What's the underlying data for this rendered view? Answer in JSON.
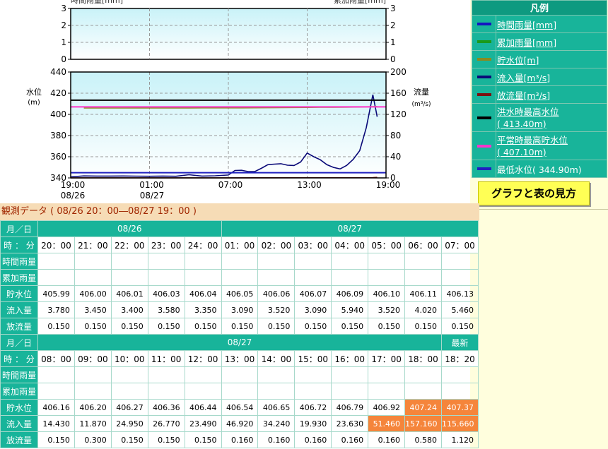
{
  "colors": {
    "teal": "#18b49a",
    "rain_hourly": "#1515c0",
    "rain_cumulative": "#1a9a1a",
    "storage_level": "#8a8a20",
    "inflow": "#0a0a78",
    "outflow": "#7a1010",
    "flood_max": "#000000",
    "normal_max": "#ff33cc",
    "min_level": "#2020c0",
    "alert": "#f5853b"
  },
  "rain_chart": {
    "left_label": "時間雨量[mm]",
    "right_label": "累加雨量[mm]",
    "left_ticks": [
      "3",
      "2",
      "1",
      "0"
    ],
    "right_ticks": [
      "3",
      "2",
      "1",
      "0"
    ]
  },
  "level_chart": {
    "left_axis_label": "水位",
    "left_axis_unit": "(m)",
    "right_axis_label": "流量",
    "right_axis_unit": "(m³/s)",
    "left_ticks": [
      "440",
      "420",
      "400",
      "380",
      "360",
      "340"
    ],
    "right_ticks": [
      "200",
      "160",
      "120",
      "80",
      "40",
      "0"
    ],
    "x_ticks": [
      "19:00",
      "01:00",
      "07:00",
      "13:00",
      "19:00"
    ],
    "date_labels": [
      "08/26",
      "08/27"
    ]
  },
  "chart_data": {
    "type": "line",
    "x_unit": "hours since 08/26 19:00",
    "x_ticks": [
      "19:00",
      "01:00",
      "07:00",
      "13:00",
      "19:00"
    ],
    "y_left": {
      "label": "水位 (m)",
      "range": [
        340,
        440
      ]
    },
    "y_right": {
      "label": "流量 (m³/s)",
      "range": [
        0,
        200
      ]
    },
    "series": [
      {
        "name": "流入量[m³/s]",
        "axis": "right",
        "color": "#0a0a78",
        "points": [
          [
            0,
            2.0
          ],
          [
            1,
            3.78
          ],
          [
            2,
            3.45
          ],
          [
            3,
            3.4
          ],
          [
            4,
            3.58
          ],
          [
            5,
            3.35
          ],
          [
            6,
            3.09
          ],
          [
            7,
            3.52
          ],
          [
            8,
            3.09
          ],
          [
            9,
            5.94
          ],
          [
            10,
            3.52
          ],
          [
            11,
            4.02
          ],
          [
            12,
            5.46
          ],
          [
            12.5,
            14.0
          ],
          [
            13,
            14.43
          ],
          [
            13.5,
            12.0
          ],
          [
            14,
            11.87
          ],
          [
            14.5,
            18.0
          ],
          [
            15,
            24.95
          ],
          [
            15.5,
            26.0
          ],
          [
            16,
            26.77
          ],
          [
            16.5,
            24.0
          ],
          [
            17,
            23.49
          ],
          [
            17.5,
            30.0
          ],
          [
            18,
            46.92
          ],
          [
            18.5,
            40.0
          ],
          [
            19,
            34.24
          ],
          [
            19.5,
            25.0
          ],
          [
            20,
            19.93
          ],
          [
            20.5,
            17.0
          ],
          [
            21,
            23.63
          ],
          [
            21.5,
            35.0
          ],
          [
            22,
            51.46
          ],
          [
            22.5,
            95.0
          ],
          [
            23,
            157.16
          ],
          [
            23.33,
            115.66
          ]
        ]
      },
      {
        "name": "放流量[m³/s]",
        "axis": "right",
        "color": "#7a1010",
        "points": [
          [
            0,
            0.15
          ],
          [
            12,
            0.15
          ],
          [
            14,
            0.3
          ],
          [
            23,
            0.58
          ],
          [
            23.33,
            1.12
          ]
        ]
      },
      {
        "name": "貯水位[m]",
        "axis": "left",
        "color": "#8a8a20",
        "points": [
          [
            1,
            405.99
          ],
          [
            2,
            406.0
          ],
          [
            3,
            406.01
          ],
          [
            4,
            406.03
          ],
          [
            5,
            406.04
          ],
          [
            6,
            406.05
          ],
          [
            7,
            406.06
          ],
          [
            8,
            406.07
          ],
          [
            9,
            406.09
          ],
          [
            10,
            406.1
          ],
          [
            11,
            406.11
          ],
          [
            12,
            406.13
          ],
          [
            13,
            406.16
          ],
          [
            14,
            406.2
          ],
          [
            15,
            406.27
          ],
          [
            16,
            406.36
          ],
          [
            17,
            406.44
          ],
          [
            18,
            406.54
          ],
          [
            19,
            406.65
          ],
          [
            20,
            406.72
          ],
          [
            21,
            406.79
          ],
          [
            22,
            406.92
          ],
          [
            23,
            407.24
          ],
          [
            23.33,
            407.37
          ]
        ]
      },
      {
        "name": "洪水時最高水位",
        "axis": "left",
        "color": "#000000",
        "constant": 413.4
      },
      {
        "name": "平常時最高貯水位",
        "axis": "left",
        "color": "#ff33cc",
        "constant": 407.1
      },
      {
        "name": "最低水位",
        "axis": "left",
        "color": "#2020c0",
        "constant": 344.9
      }
    ]
  },
  "legend": {
    "title": "凡例",
    "items": [
      {
        "color": "#1515c0",
        "lines": [
          "時間雨量[mm]"
        ],
        "link": true,
        "tall": false
      },
      {
        "color": "#1a9a1a",
        "lines": [
          "累加雨量[mm]"
        ],
        "link": true,
        "tall": false
      },
      {
        "color": "#8a8a20",
        "lines": [
          "貯水位[m]"
        ],
        "link": true,
        "tall": false
      },
      {
        "color": "#0a0a78",
        "lines": [
          "流入量[m³/s]"
        ],
        "link": true,
        "tall": false
      },
      {
        "color": "#7a1010",
        "lines": [
          "放流量[m³/s]"
        ],
        "link": true,
        "tall": false
      },
      {
        "color": "#000000",
        "lines": [
          "洪水時最高水位",
          "( 413.40m)"
        ],
        "link": true,
        "tall": true
      },
      {
        "color": "#ff33cc",
        "lines": [
          "平常時最高貯水位",
          "( 407.10m)"
        ],
        "link": true,
        "tall": true
      },
      {
        "color": "#2020c0",
        "lines": [
          "最低水位( 344.90m)"
        ],
        "link": false,
        "tall": false
      }
    ]
  },
  "guide_button": "グラフと表の見方",
  "observation": {
    "title": "観測データ ( 08/26 20：00―08/27 19：00 )",
    "row_labels": {
      "date": "月／日",
      "time": "時 ： 分",
      "hourly_rain": "時間雨量",
      "cumulative_rain": "累加雨量",
      "level": "貯水位",
      "inflow": "流入量",
      "outflow": "放流量"
    },
    "table1": {
      "date_groups": [
        {
          "label": "08/26",
          "span": 5
        },
        {
          "label": "08/27",
          "span": 7
        }
      ],
      "times": [
        "20：00",
        "21：00",
        "22：00",
        "23：00",
        "24：00",
        "01：00",
        "02：00",
        "03：00",
        "04：00",
        "05：00",
        "06：00",
        "07：00"
      ],
      "hourly_rain": [
        "",
        "",
        "",
        "",
        "",
        "",
        "",
        "",
        "",
        "",
        "",
        ""
      ],
      "cumulative_rain": [
        "",
        "",
        "",
        "",
        "",
        "",
        "",
        "",
        "",
        "",
        "",
        ""
      ],
      "level": [
        "405.99",
        "406.00",
        "406.01",
        "406.03",
        "406.04",
        "406.05",
        "406.06",
        "406.07",
        "406.09",
        "406.10",
        "406.11",
        "406.13"
      ],
      "inflow": [
        "3.780",
        "3.450",
        "3.400",
        "3.580",
        "3.350",
        "3.090",
        "3.520",
        "3.090",
        "5.940",
        "3.520",
        "4.020",
        "5.460"
      ],
      "outflow": [
        "0.150",
        "0.150",
        "0.150",
        "0.150",
        "0.150",
        "0.150",
        "0.150",
        "0.150",
        "0.150",
        "0.150",
        "0.150",
        "0.150"
      ],
      "alerts": {
        "level": [],
        "inflow": []
      }
    },
    "table2": {
      "date_groups": [
        {
          "label": "08/27",
          "span": 11
        },
        {
          "label": "最新",
          "span": 1
        }
      ],
      "times": [
        "08：00",
        "09：00",
        "10：00",
        "11：00",
        "12：00",
        "13：00",
        "14：00",
        "15：00",
        "16：00",
        "17：00",
        "18：00",
        "18：20"
      ],
      "hourly_rain": [
        "",
        "",
        "",
        "",
        "",
        "",
        "",
        "",
        "",
        "",
        "",
        ""
      ],
      "cumulative_rain": [
        "",
        "",
        "",
        "",
        "",
        "",
        "",
        "",
        "",
        "",
        "",
        ""
      ],
      "level": [
        "406.16",
        "406.20",
        "406.27",
        "406.36",
        "406.44",
        "406.54",
        "406.65",
        "406.72",
        "406.79",
        "406.92",
        "407.24",
        "407.37"
      ],
      "inflow": [
        "14.430",
        "11.870",
        "24.950",
        "26.770",
        "23.490",
        "46.920",
        "34.240",
        "19.930",
        "23.630",
        "51.460",
        "157.160",
        "115.660"
      ],
      "outflow": [
        "0.150",
        "0.300",
        "0.150",
        "0.150",
        "0.150",
        "0.160",
        "0.160",
        "0.160",
        "0.160",
        "0.160",
        "0.580",
        "1.120"
      ],
      "alerts": {
        "level": [
          10,
          11
        ],
        "inflow": [
          9,
          10,
          11
        ]
      }
    }
  }
}
